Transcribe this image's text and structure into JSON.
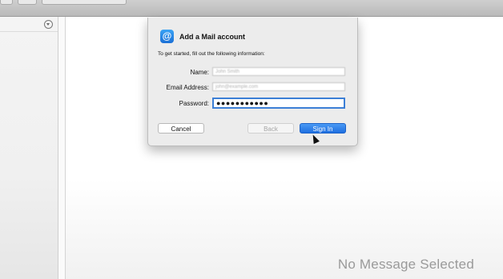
{
  "dialog": {
    "title": "Add a Mail account",
    "intro": "To get started, fill out the following information:",
    "fields": {
      "name_label": "Name:",
      "name_placeholder": "John Smith",
      "email_label": "Email Address:",
      "email_placeholder": "john@example.com",
      "password_label": "Password:",
      "password_value": "●●●●●●●●●●●"
    },
    "buttons": {
      "cancel": "Cancel",
      "back": "Back",
      "sign_in": "Sign In"
    },
    "icon": "at-sign-icon"
  },
  "main": {
    "empty_state": "No Message Selected"
  },
  "colors": {
    "accent": "#1f6fe0",
    "focus_ring": "#3c7fd6"
  }
}
